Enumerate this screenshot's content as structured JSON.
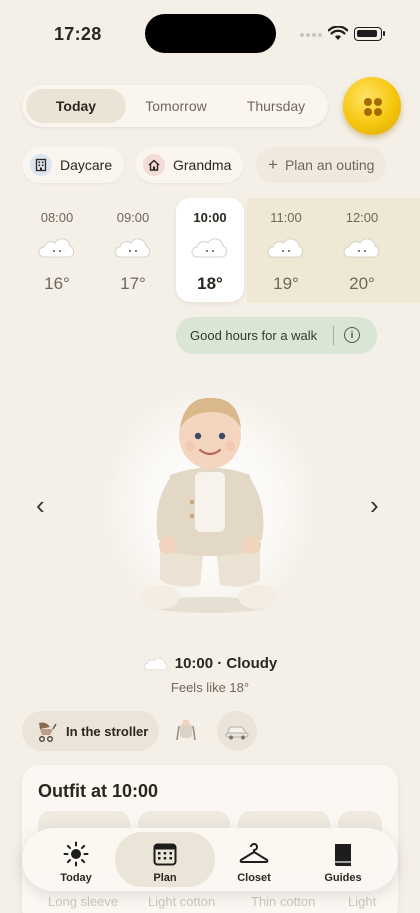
{
  "status_bar": {
    "time": "17:28"
  },
  "day_tabs": [
    {
      "label": "Today",
      "active": true
    },
    {
      "label": "Tomorrow",
      "active": false
    },
    {
      "label": "Thursday",
      "active": false
    }
  ],
  "locations": [
    {
      "label": "Daycare",
      "icon": "building-icon"
    },
    {
      "label": "Grandma",
      "icon": "house-icon"
    },
    {
      "label": "Plan an outing",
      "icon": "plus-icon"
    }
  ],
  "hourly": [
    {
      "time": "08:00",
      "temp": "16°",
      "icon": "cloud-icon"
    },
    {
      "time": "09:00",
      "temp": "17°",
      "icon": "cloud-icon"
    },
    {
      "time": "10:00",
      "temp": "18°",
      "icon": "cloud-icon",
      "active": true
    },
    {
      "time": "11:00",
      "temp": "19°",
      "icon": "cloud-icon"
    },
    {
      "time": "12:00",
      "temp": "20°",
      "icon": "cloud-icon"
    }
  ],
  "walk_hint": {
    "label": "Good hours for a walk",
    "icon": "info-icon"
  },
  "forecast": {
    "summary": "10:00 · Cloudy",
    "feels_like": "Feels like 18°"
  },
  "modes": [
    {
      "label": "In the stroller",
      "icon": "stroller-icon"
    },
    {
      "icon": "baby-carrier-icon"
    },
    {
      "icon": "car-seat-icon"
    }
  ],
  "outfit": {
    "title": "Outfit at 10:00",
    "items": [
      "Long sleeve",
      "Light cotton",
      "Thin cotton",
      "Light"
    ]
  },
  "tab_bar": [
    {
      "label": "Today",
      "icon": "sun-icon"
    },
    {
      "label": "Plan",
      "icon": "calendar-icon",
      "active": true
    },
    {
      "label": "Closet",
      "icon": "hanger-icon"
    },
    {
      "label": "Guides",
      "icon": "book-icon"
    }
  ],
  "colors": {
    "background": "#f4efe7",
    "accent_yellow": "#f6c60e",
    "walk_green": "#d9e5d5",
    "highlight_band": "#efe8d4"
  }
}
